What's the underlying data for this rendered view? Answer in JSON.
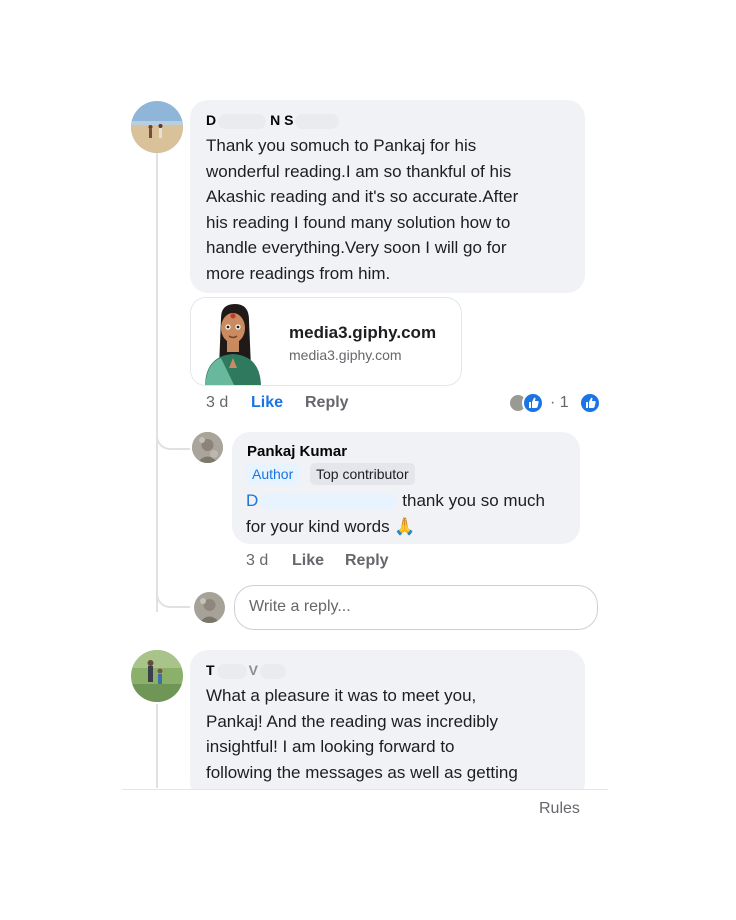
{
  "comment1": {
    "author_first": "D",
    "author_second": "N S",
    "text": "Thank you somuch to Pankaj for his\nwonderful reading.I am so thankful of his\nAkashic reading and it's so accurate.After\nhis reading I found many solution  how to\nhandle everything.Very soon I will go for\nmore readings from him.",
    "link_preview": {
      "title": "media3.giphy.com",
      "domain": "media3.giphy.com"
    },
    "time": "3 d",
    "like_label": "Like",
    "reply_label": "Reply",
    "reaction_count": "· 1"
  },
  "reply1": {
    "author": "Pankaj Kumar",
    "badge_author": "Author",
    "badge_top": "Top contributor",
    "mention_initial": "D",
    "text_line1": "thank you so much",
    "text_line2": "for your kind words 🙏",
    "time": "3 d",
    "like_label": "Like",
    "reply_label": "Reply"
  },
  "reply_box": {
    "placeholder": "Write a reply..."
  },
  "comment2": {
    "author_first": "T",
    "author_second": "V",
    "text": "What a pleasure it was to meet you,\nPankaj!  And the reading was incredibly\ninsightful!  I am looking forward to\nfollowing the messages as well as getting"
  },
  "footer": {
    "rules_label": "Rules"
  },
  "colors": {
    "bubble": "#f0f2f5",
    "like_active": "#1b74e4",
    "secondary_text": "#65676b"
  }
}
